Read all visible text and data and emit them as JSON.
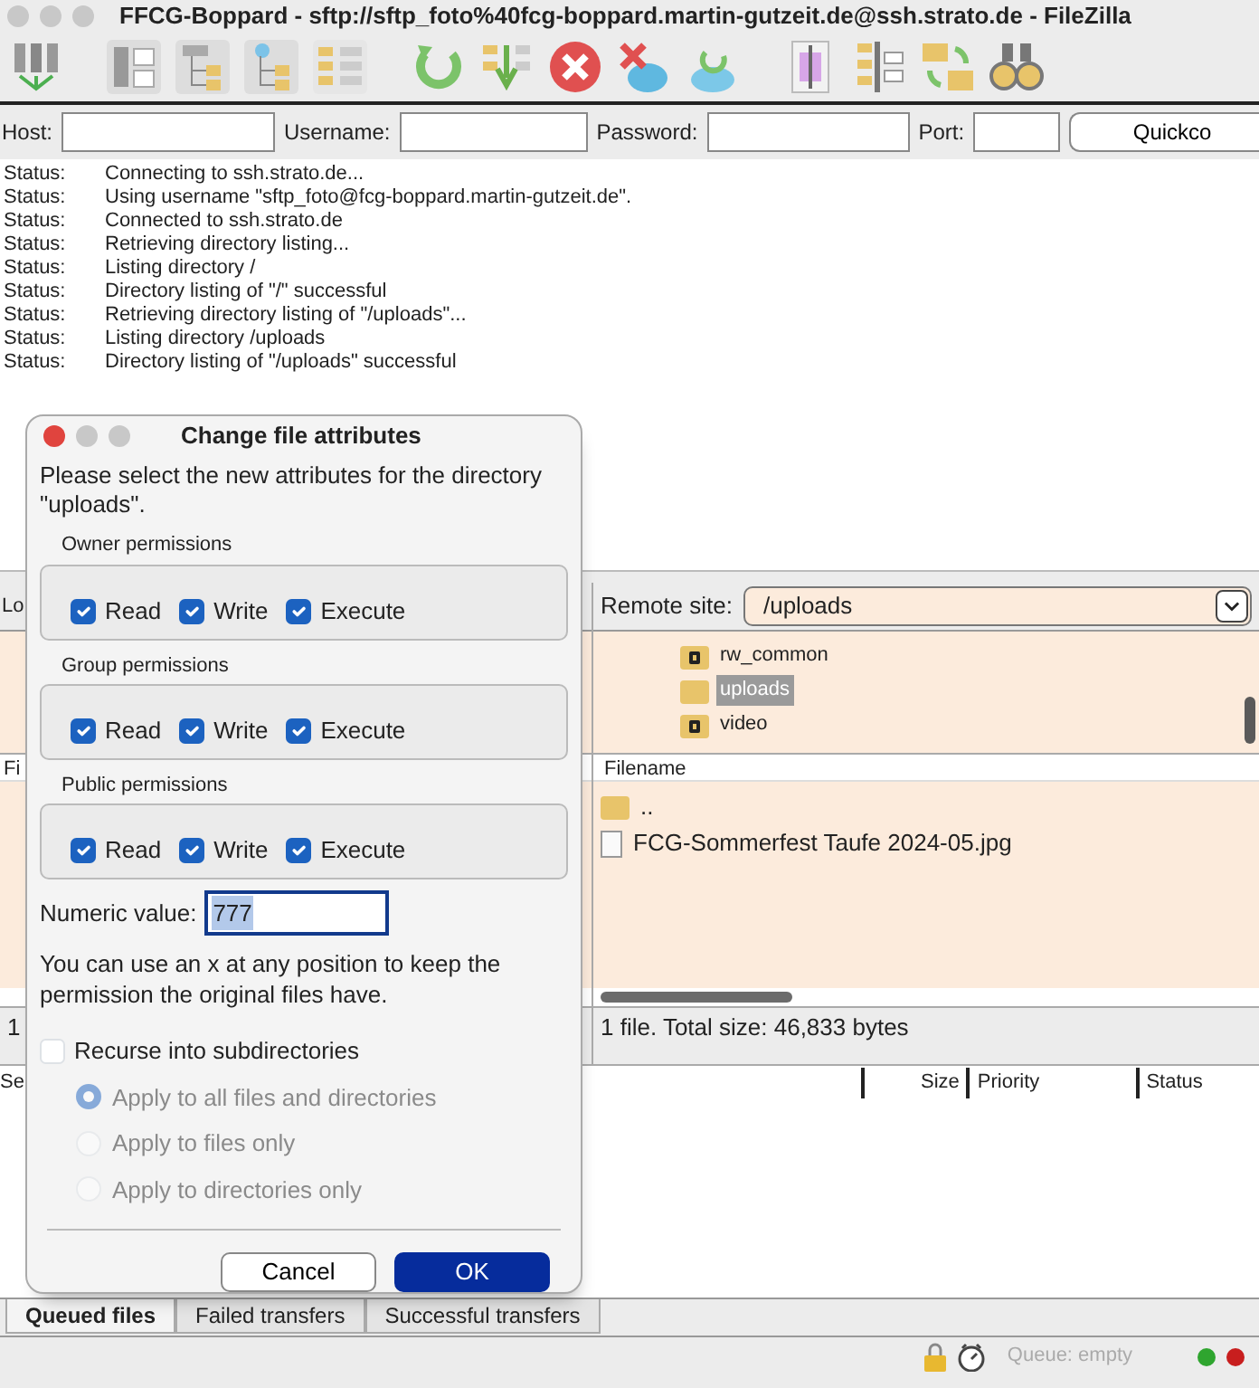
{
  "window": {
    "title": "FFCG-Boppard - sftp://sftp_foto%40fcg-boppard.martin-gutzeit.de@ssh.strato.de - FileZilla"
  },
  "toolbar": {
    "groups": [
      [
        {
          "kind": "servers"
        }
      ],
      [
        {
          "kind": "panels"
        },
        {
          "kind": "tree"
        },
        {
          "kind": "tree2"
        },
        {
          "kind": "list"
        }
      ],
      [
        {
          "kind": "refresh"
        },
        {
          "kind": "queue"
        },
        {
          "kind": "cancel"
        },
        {
          "kind": "disconnect"
        },
        {
          "kind": "reconnect"
        }
      ],
      [
        {
          "kind": "compare"
        },
        {
          "kind": "sync"
        },
        {
          "kind": "syncdir"
        },
        {
          "kind": "binoculars"
        }
      ]
    ]
  },
  "quickconnect": {
    "fields": [
      {
        "label": "Host:"
      },
      {
        "label": "Username:"
      },
      {
        "label": "Password:"
      },
      {
        "label": "Port:"
      }
    ],
    "button": "Quickco"
  },
  "log": [
    {
      "label": "Status:",
      "message": "Connecting to ssh.strato.de..."
    },
    {
      "label": "Status:",
      "message": "Using username \"sftp_foto@fcg-boppard.martin-gutzeit.de\"."
    },
    {
      "label": "Status:",
      "message": "Connected to ssh.strato.de"
    },
    {
      "label": "Status:",
      "message": "Retrieving directory listing..."
    },
    {
      "label": "Status:",
      "message": "Listing directory /"
    },
    {
      "label": "Status:",
      "message": "Directory listing of \"/\" successful"
    },
    {
      "label": "Status:",
      "message": "Retrieving directory listing of \"/uploads\"..."
    },
    {
      "label": "Status:",
      "message": "Listing directory /uploads"
    },
    {
      "label": "Status:",
      "message": "Directory listing of \"/uploads\" successful"
    }
  ],
  "local": {
    "site_label": "Lo",
    "column_1": "Fi",
    "status": "1"
  },
  "remote": {
    "site_label": "Remote site:",
    "path": "/uploads",
    "tree": [
      {
        "name": "rw_common",
        "kind": "unknown",
        "selected": false
      },
      {
        "name": "uploads",
        "kind": "folder",
        "selected": true
      },
      {
        "name": "video",
        "kind": "unknown",
        "selected": false
      }
    ],
    "columns": [
      "Filename"
    ],
    "files": [
      {
        "name": "..",
        "kind": "folder"
      },
      {
        "name": "FCG-Sommerfest Taufe 2024-05.jpg",
        "kind": "file"
      }
    ],
    "status": "1 file. Total size: 46,833 bytes"
  },
  "queue": {
    "columns": [
      "Se",
      "",
      "Size",
      "Priority",
      "Status"
    ],
    "tabs": [
      {
        "label": "Queued files",
        "selected": true
      },
      {
        "label": "Failed transfers",
        "selected": false
      },
      {
        "label": "Successful transfers",
        "selected": false
      }
    ]
  },
  "status_bar": {
    "queue": "Queue: empty",
    "lights": [
      {
        "color": "#2fa52f"
      },
      {
        "color": "#c81e1e"
      }
    ]
  },
  "dialog": {
    "title": "Change file attributes",
    "intro": "Please select the new attributes for the directory \"uploads\".",
    "groups": [
      {
        "title": "Owner permissions",
        "perms": [
          {
            "label": "Read",
            "checked": true
          },
          {
            "label": "Write",
            "checked": true
          },
          {
            "label": "Execute",
            "checked": true
          }
        ]
      },
      {
        "title": "Group permissions",
        "perms": [
          {
            "label": "Read",
            "checked": true
          },
          {
            "label": "Write",
            "checked": true
          },
          {
            "label": "Execute",
            "checked": true
          }
        ]
      },
      {
        "title": "Public permissions",
        "perms": [
          {
            "label": "Read",
            "checked": true
          },
          {
            "label": "Write",
            "checked": true
          },
          {
            "label": "Execute",
            "checked": true
          }
        ]
      }
    ],
    "numeric_label": "Numeric value:",
    "numeric_value": "777",
    "hint": "You can use an x at any position to keep the permission the original files have.",
    "recurse": {
      "label": "Recurse into subdirectories",
      "checked": false
    },
    "apply": {
      "disabled": true,
      "options": [
        {
          "label": "Apply to all files and directories",
          "selected": true
        },
        {
          "label": "Apply to files only",
          "selected": false
        },
        {
          "label": "Apply to directories only",
          "selected": false
        }
      ]
    },
    "buttons": [
      {
        "label": "Cancel",
        "kind": "cancel"
      },
      {
        "label": "OK",
        "kind": "default"
      }
    ]
  }
}
